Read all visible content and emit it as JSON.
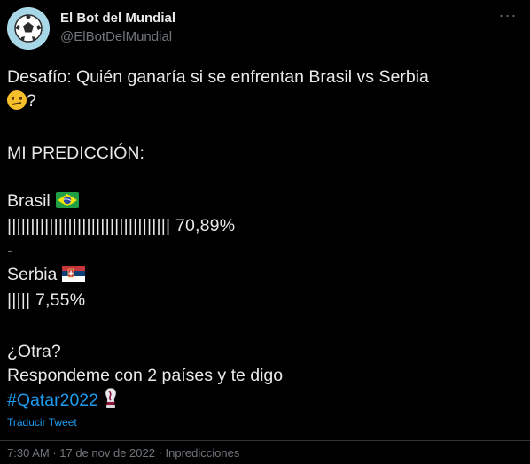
{
  "tweet": {
    "author_name": "El Bot del Mundial",
    "author_handle": "@ElBotDelMundial",
    "avatar_icon": "soccer-ball-icon",
    "more_icon": "more-options-icon",
    "challenge_line1": "Desafío: Quién ganaría si se enfrentan Brasil vs Serbia",
    "challenge_suffix": "?",
    "prediction_header": "MI PREDICCIÓN:",
    "team1_name": "Brasil",
    "team1_flag": "brazil-flag-icon",
    "team1_bars": "|||||||||||||||||||||||||||||||||||",
    "team1_percent": "70,89%",
    "separator": "-",
    "team2_name": "Serbia",
    "team2_flag": "serbia-flag-icon",
    "team2_bars": "|||||",
    "team2_percent": "7,55%",
    "another": "¿Otra?",
    "reply_prompt": "Respondeme con 2 países y te digo",
    "hashtag": "#Qatar2022",
    "trophy_icon": "world-cup-trophy-icon",
    "translate_label": "Traducir Tweet",
    "timestamp": "7:30 AM · 17 de nov de 2022 · Inpredicciones"
  },
  "colors": {
    "background": "#000000",
    "text": "#e7e9ea",
    "secondary": "#71767b",
    "accent": "#1d9bf0"
  }
}
